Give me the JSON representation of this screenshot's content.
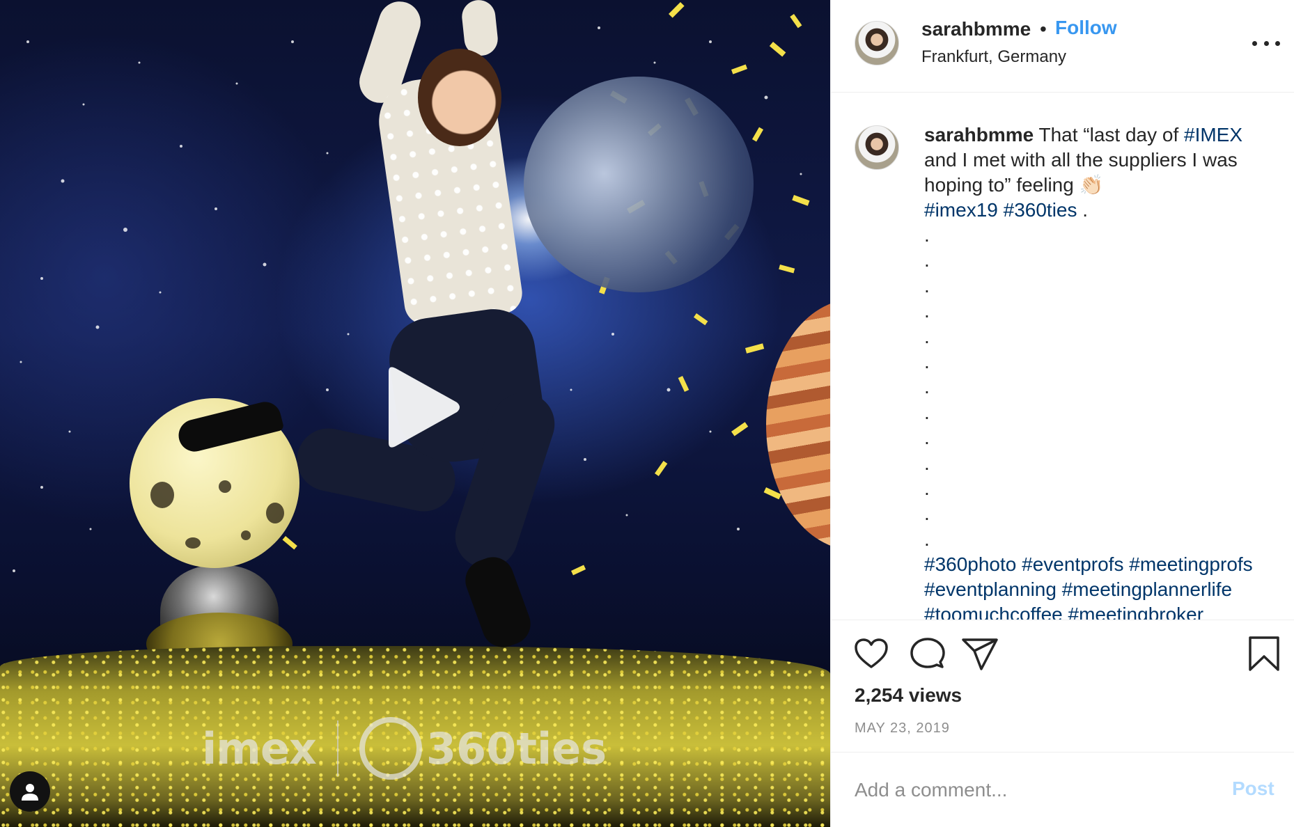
{
  "post": {
    "username": "sarahbmme",
    "follow_label": "Follow",
    "separator": "•",
    "location": "Frankfurt, Germany",
    "caption_text_1": " That “last day of ",
    "caption_tag_imex": "#IMEX",
    "caption_text_2": " and I met with all the suppliers I was hoping to” feeling ",
    "caption_emoji": "👏🏻",
    "caption_tag_imex19": "#imex19",
    "caption_tag_360ties": "#360ties",
    "caption_period": " .",
    "caption_dots": ".",
    "hashtags": [
      "#360photo",
      "#eventprofs",
      "#meetingprofs",
      "#eventplanning",
      "#meetingplannerlife",
      "#toomuchcoffee",
      "#meetingbroker"
    ],
    "views": "2,254 views",
    "date": "MAY 23, 2019"
  },
  "media": {
    "logo_imex": "imex",
    "logo_360": "360ties"
  },
  "comment": {
    "placeholder": "Add a comment...",
    "post_label": "Post"
  },
  "colors": {
    "link_blue": "#3897f0",
    "hashtag": "#003569",
    "post_disabled": "#b3dbff"
  },
  "icons": [
    "play-icon",
    "user-tag-icon",
    "more-options-icon",
    "heart-icon",
    "comment-icon",
    "share-icon",
    "bookmark-icon"
  ]
}
